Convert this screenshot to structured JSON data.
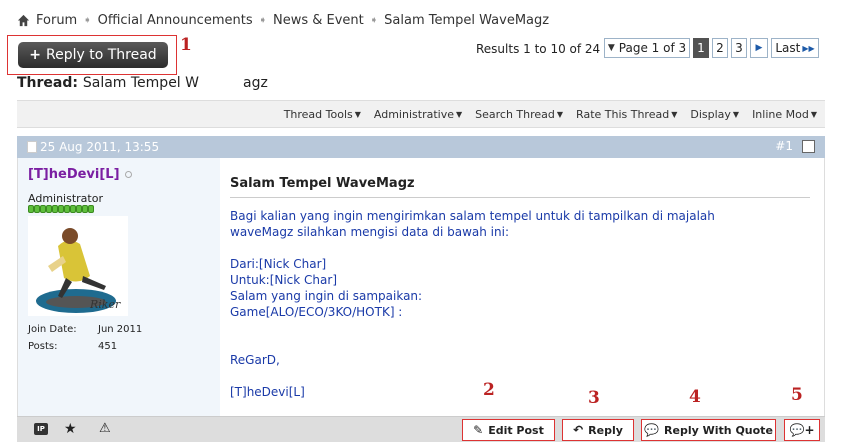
{
  "breadcrumb": {
    "items": [
      "Forum",
      "Official Announcements",
      "News & Event",
      "Salam Tempel WaveMagz"
    ]
  },
  "reply_thread": {
    "label": "Reply to Thread",
    "marker": "1"
  },
  "results_text": "Results 1 to 10 of 24",
  "pagination": {
    "page_label": "Page 1 of 3",
    "pages": [
      "1",
      "2",
      "3"
    ],
    "current": "1",
    "last_label": "Last"
  },
  "thread": {
    "prefix": "Thread:",
    "title": "Salam Tempel W",
    "title_tail": "agz"
  },
  "toolbar": {
    "items": [
      "Thread Tools",
      "Administrative",
      "Search Thread",
      "Rate This Thread",
      "Display",
      "Inline Mod"
    ]
  },
  "post": {
    "date": "25 Aug 2011, 13:55",
    "number": "#1",
    "username": "[T]heDevi[L]",
    "user_title": "Administrator",
    "join_label": "Join Date:",
    "join_value": "Jun 2011",
    "posts_label": "Posts:",
    "posts_value": "451",
    "title": "Salam Tempel WaveMagz",
    "lines": [
      "Bagi kalian yang ingin mengirimkan salam tempel untuk di tampilkan di majalah",
      "waveMagz silahkan mengisi data di bawah ini:",
      "",
      "Dari:[Nick Char]",
      "Untuk:[Nick Char]",
      "Salam yang ingin di sampaikan:",
      "Game[ALO/ECO/3KO/HOTK] :",
      "",
      "",
      "ReGarD,",
      "",
      "[T]heDevi[L]"
    ]
  },
  "footer": {
    "ip_label": "IP",
    "buttons": {
      "edit": "Edit Post",
      "reply": "Reply",
      "quote": "Reply With Quote"
    },
    "markers": [
      "2",
      "3",
      "4",
      "5"
    ]
  },
  "colors": {
    "header_blue": "#b8c8da",
    "username_purple": "#7b1fa2",
    "post_text_blue": "#1a3aa8",
    "marker_red": "#b22222"
  }
}
